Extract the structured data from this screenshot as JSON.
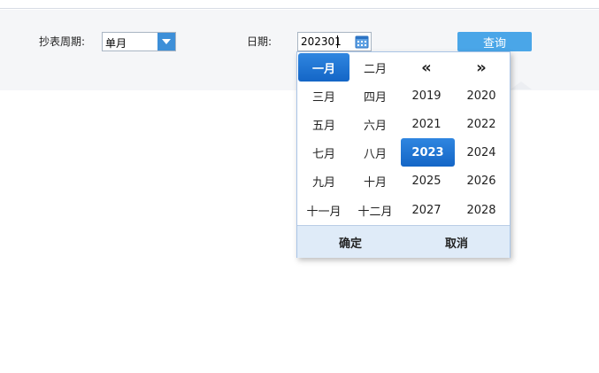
{
  "toolbar": {
    "period_label": "抄表周期:",
    "period_value": "单月",
    "date_label": "日期:",
    "date_value": "202301",
    "query_label": "查询"
  },
  "picker": {
    "months": [
      "一月",
      "二月",
      "三月",
      "四月",
      "五月",
      "六月",
      "七月",
      "八月",
      "九月",
      "十月",
      "十一月",
      "十二月"
    ],
    "prev_label": "«",
    "next_label": "»",
    "years": [
      "2019",
      "2020",
      "2021",
      "2022",
      "2023",
      "2024",
      "2025",
      "2026",
      "2027",
      "2028"
    ],
    "selected_month": "一月",
    "selected_year": "2023",
    "confirm_label": "确定",
    "cancel_label": "取消"
  },
  "colors": {
    "accent": "#1a6fd0",
    "query_button": "#4aa6e8",
    "dropdown_arrow": "#3d8fd8",
    "footer_bg": "#dfebf8"
  },
  "icons": {
    "select_arrow": "chevron-down-icon",
    "date_picker": "calendar-icon"
  }
}
